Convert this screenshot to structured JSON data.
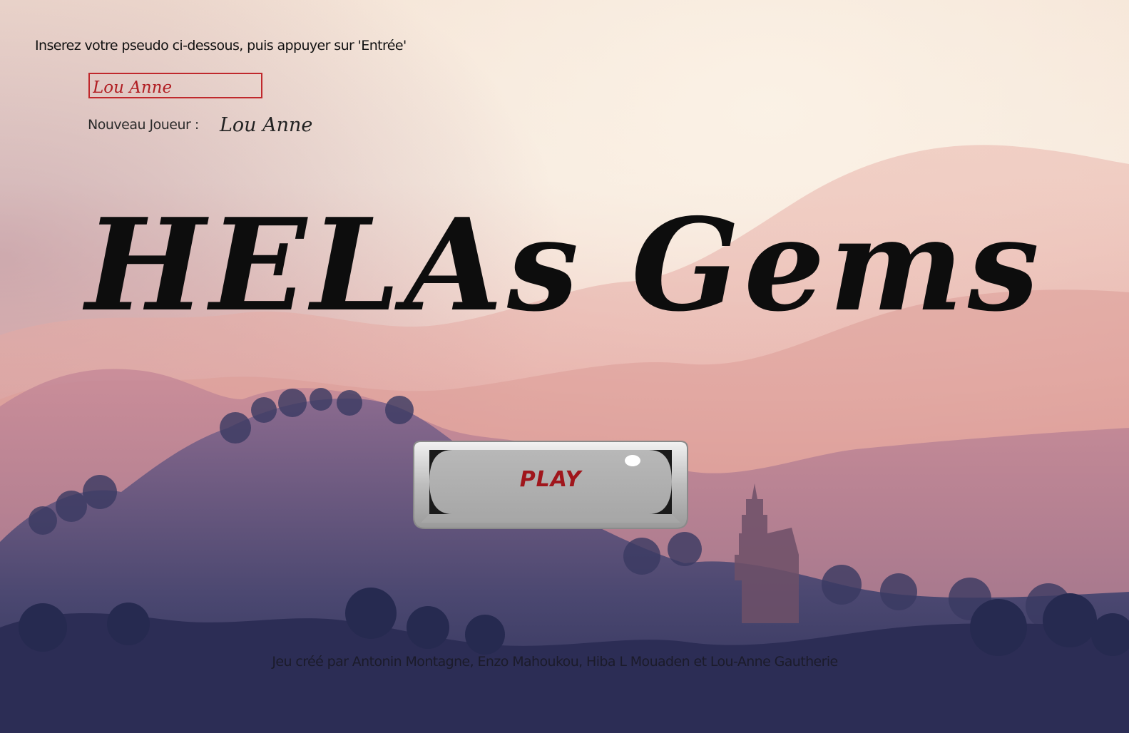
{
  "login": {
    "instruction": "Inserez votre pseudo ci-dessous, puis appuyer sur 'Entrée'",
    "pseudo_value": "Lou Anne",
    "new_player_label": "Nouveau Joueur :",
    "new_player_value": "Lou Anne"
  },
  "title": "HELAs Gems",
  "play_button": {
    "label": "PLAY"
  },
  "credits": "Jeu créé par Antonin Montagne, Enzo Mahoukou, Hiba L Mouaden et Lou-Anne Gautherie",
  "colors": {
    "input_border": "#c0282c",
    "input_text": "#b11e23",
    "play_text": "#a0161c",
    "title": "#0d0d0d"
  }
}
